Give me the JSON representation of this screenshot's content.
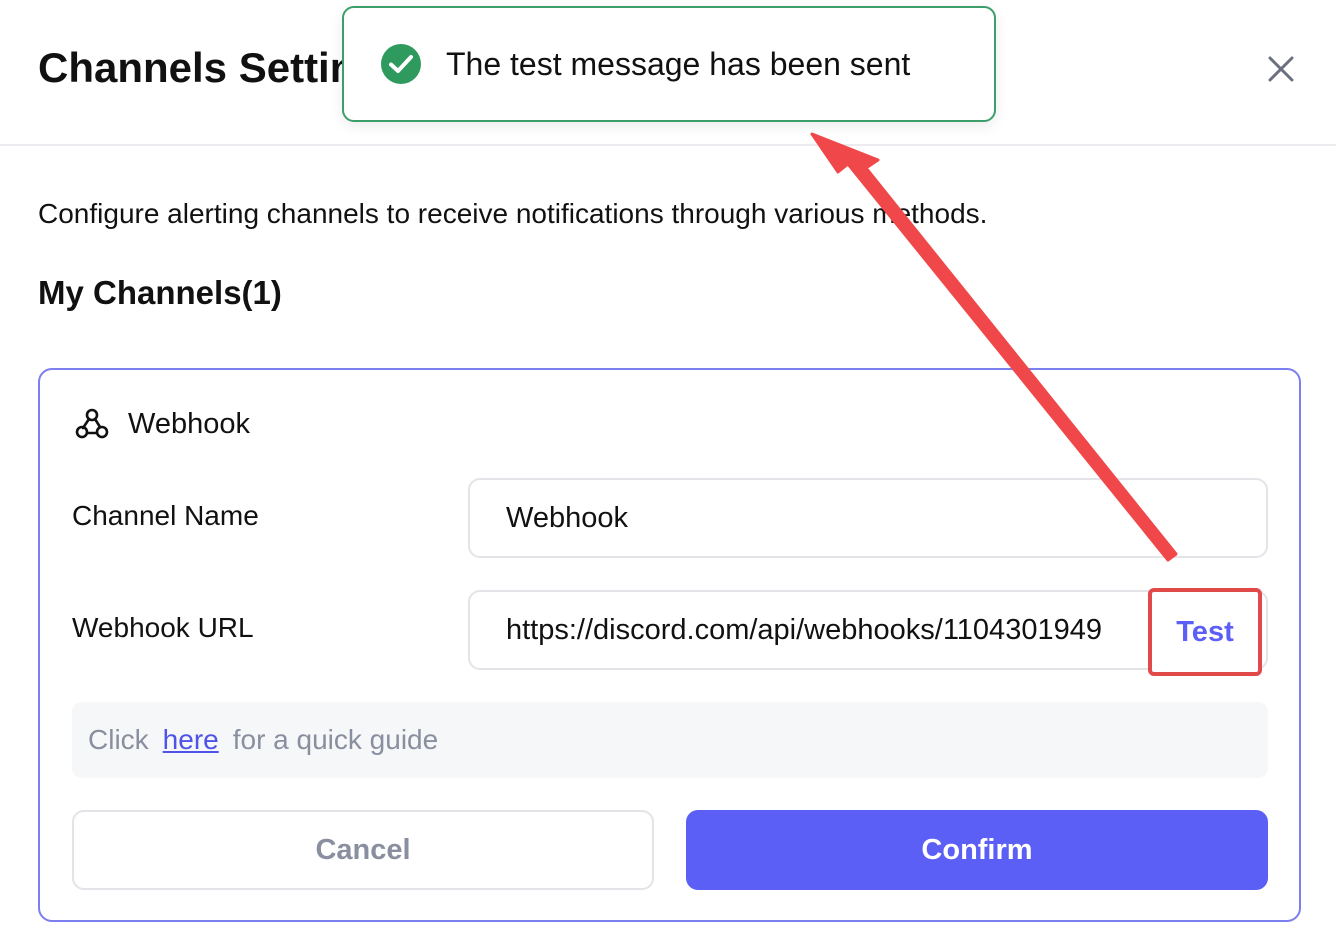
{
  "dialog": {
    "title": "Channels Settings",
    "close_icon": "close-icon"
  },
  "description": "Configure alerting channels to receive notifications through various methods.",
  "section_title": "My Channels(1)",
  "channel": {
    "type_icon": "webhook-icon",
    "type_label": "Webhook",
    "name_label": "Channel Name",
    "name_value": "Webhook",
    "url_label": "Webhook URL",
    "url_value": "https://discord.com/api/webhooks/1104301949",
    "test_label": "Test"
  },
  "guide": {
    "prefix": "Click",
    "link": "here",
    "suffix": "for a quick guide"
  },
  "buttons": {
    "cancel": "Cancel",
    "confirm": "Confirm"
  },
  "toast": {
    "icon": "check-circle-icon",
    "message": "The test message has been sent"
  },
  "colors": {
    "accent": "#5b5ff5",
    "success": "#2e9a5e",
    "annotation": "#e24a4a"
  }
}
